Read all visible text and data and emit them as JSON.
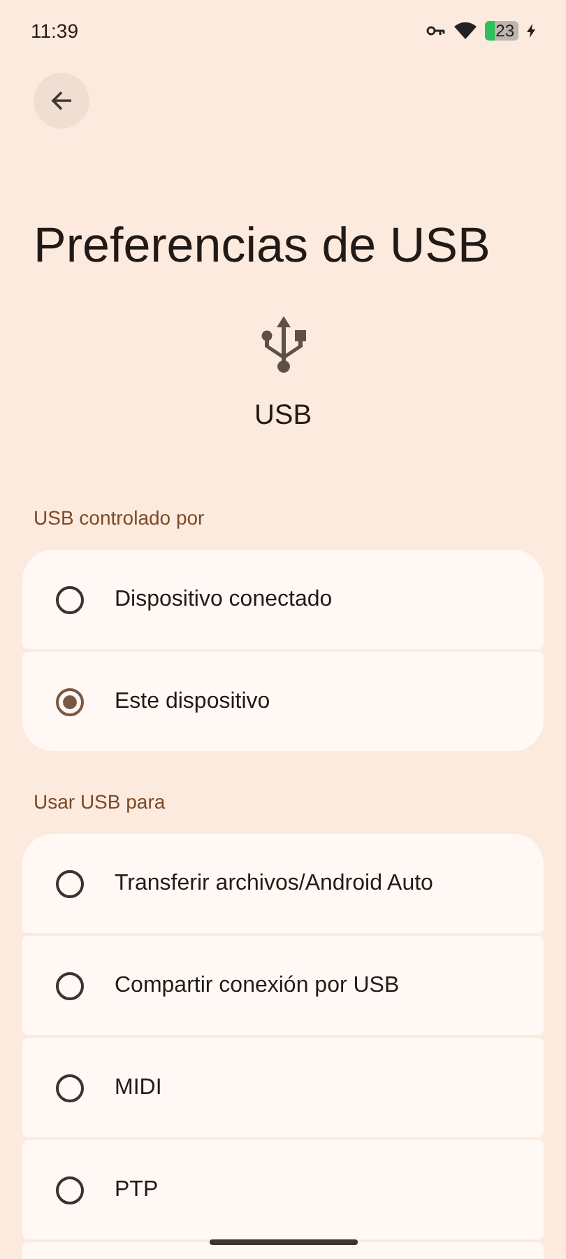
{
  "status_bar": {
    "time": "11:39",
    "battery": "23"
  },
  "title": "Preferencias de USB",
  "header_label": "USB",
  "sections": [
    {
      "label": "USB controlado por",
      "options": [
        {
          "label": "Dispositivo conectado",
          "selected": false
        },
        {
          "label": "Este dispositivo",
          "selected": true
        }
      ]
    },
    {
      "label": "Usar USB para",
      "options": [
        {
          "label": "Transferir archivos/Android Auto",
          "selected": false
        },
        {
          "label": "Compartir conexión por USB",
          "selected": false
        },
        {
          "label": "MIDI",
          "selected": false
        },
        {
          "label": "PTP",
          "selected": false
        }
      ]
    }
  ]
}
